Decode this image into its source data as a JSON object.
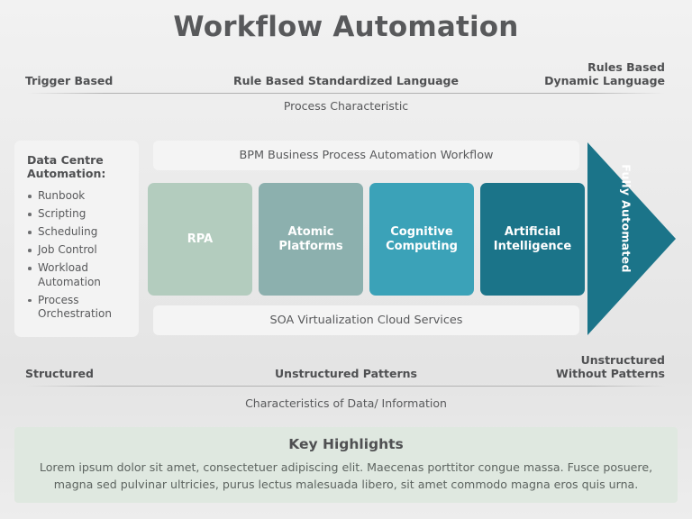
{
  "slide": {
    "title": "Workflow Automation"
  },
  "top_axis": {
    "left": "Trigger Based",
    "center": "Rule Based Standardized Language",
    "right_line1": "Rules Based",
    "right_line2": "Dynamic Language",
    "caption": "Process Characteristic"
  },
  "bottom_axis": {
    "left": "Structured",
    "center": "Unstructured Patterns",
    "right_line1": "Unstructured",
    "right_line2": "Without Patterns",
    "caption": "Characteristics of Data/ Information"
  },
  "sidebar": {
    "title_line1": "Data Centre",
    "title_line2": "Automation:",
    "items": [
      "Runbook",
      "Scripting",
      "Scheduling",
      "Job Control",
      "Workload Automation",
      "Process Orchestration"
    ]
  },
  "bars": {
    "top": "BPM Business Process Automation Workflow",
    "bottom": "SOA Virtualization Cloud Services"
  },
  "stages": [
    {
      "label": "RPA",
      "color": "#b3ccbe"
    },
    {
      "label": "Atomic Platforms",
      "line1": "Atomic",
      "line2": "Platforms",
      "color": "#8cb0ae"
    },
    {
      "label": "Cognitive Computing",
      "line1": "Cognitive",
      "line2": "Computing",
      "color": "#3ba2b8"
    },
    {
      "label": "Artificial Intelligence",
      "line1": "Artificial",
      "line2": "Intelligence",
      "color": "#1b7489"
    }
  ],
  "arrow": {
    "label_line1": "Fully",
    "label_line2": "Automated",
    "color": "#1b7489"
  },
  "highlights": {
    "title": "Key Highlights",
    "body": "Lorem ipsum dolor sit amet, consectetuer adipiscing elit. Maecenas porttitor congue massa. Fusce posuere, magna sed pulvinar ultricies, purus lectus malesuada libero, sit amet commodo magna eros quis urna.",
    "background": "#dfe8e0"
  },
  "colors": {
    "title_text": "#58595b",
    "body_text": "#58595b",
    "panel": "#f3f3f3",
    "accent_dark": "#1b7489"
  }
}
